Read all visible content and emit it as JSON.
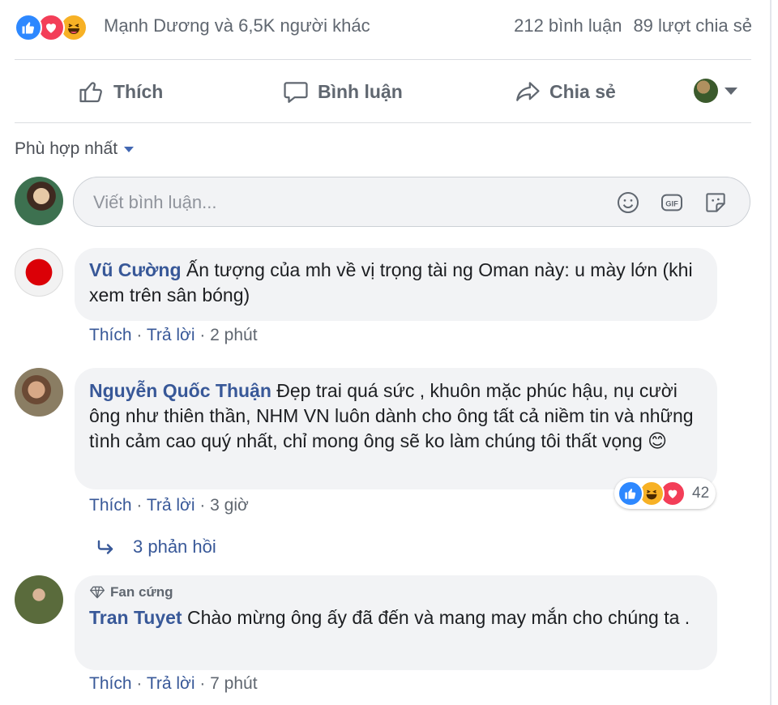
{
  "summary": {
    "reaction_names": "Mạnh Dương và 6,5K người khác",
    "comments_count": "212 bình luận",
    "shares_count": "89 lượt chia sẻ"
  },
  "actions": {
    "like": "Thích",
    "comment": "Bình luận",
    "share": "Chia sẻ"
  },
  "sort": {
    "label": "Phù hợp nhất"
  },
  "composer": {
    "placeholder": "Viết bình luận..."
  },
  "comments": [
    {
      "author": "Vũ Cường",
      "text": "Ấn tượng của mh về vị trọng tài ng Oman này: u mày lớn (khi xem trên sân bóng)",
      "like": "Thích",
      "reply": "Trả lời",
      "time": "2 phút"
    },
    {
      "author": "Nguyễn Quốc Thuận",
      "text": "Đẹp trai quá sức , khuôn mặc phúc hậu, nụ cười ông như thiên thần, NHM VN luôn dành cho ông tất cả niềm tin và những tình cảm cao quý nhất, chỉ mong ông sẽ ko làm chúng tôi thất vọng 😊",
      "like": "Thích",
      "reply": "Trả lời",
      "time": "3 giờ",
      "reaction_count": "42",
      "replies_label": "3 phản hồi"
    },
    {
      "badge": "Fan cứng",
      "author": "Tran Tuyet",
      "text": "Chào mừng ông ấy đã đến và mang may mắn cho chúng ta .",
      "like": "Thích",
      "reply": "Trả lời",
      "time": "7 phút"
    }
  ],
  "colors": {
    "link": "#385898",
    "muted": "#606770",
    "bubble": "#f2f3f5",
    "like": "#2d88ff",
    "love": "#f33e58",
    "haha": "#f7b125"
  }
}
